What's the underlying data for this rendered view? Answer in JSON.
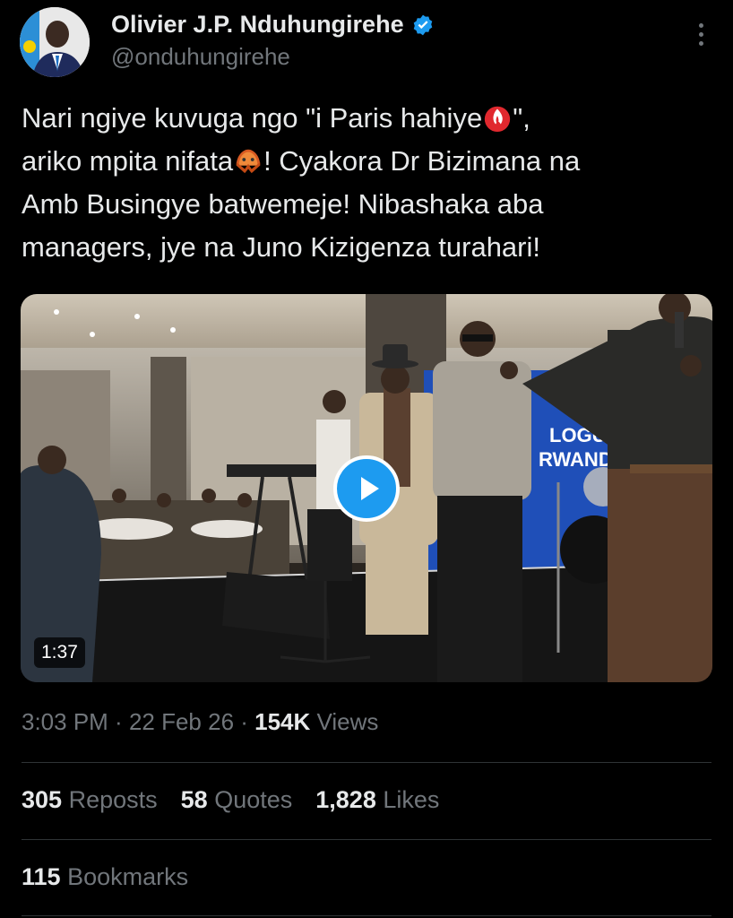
{
  "author": {
    "display_name": "Olivier J.P. Nduhungirehe",
    "handle": "@onduhungirehe",
    "verified_badge_color": "#1d9bf0"
  },
  "tweet": {
    "line1_a": "Nari ngiye kuvuga ngo \"i Paris hahiye",
    "line1_b": "\",",
    "line2_a": "ariko mpita nifata",
    "line2_b": "! Cyakora Dr Bizimana na",
    "line3": "Amb Busingye batwemeje! Nibashaka aba",
    "line4": "managers, jye na Juno Kizigenza turahari!",
    "emoji_1": "fire-emoji",
    "emoji_2": "mouth-covered-emoji"
  },
  "media": {
    "duration": "1:37",
    "play_icon": "play-icon",
    "banner_text_1": "LOGUE A",
    "banner_text_2": "RWAND"
  },
  "meta": {
    "time": "3:03 PM",
    "sep1": " · ",
    "date": "22 Feb 26",
    "sep2": " · ",
    "views_count": "154K",
    "views_label": " Views"
  },
  "stats": {
    "reposts_count": "305",
    "reposts_label": "Reposts",
    "quotes_count": "58",
    "quotes_label": "Quotes",
    "likes_count": "1,828",
    "likes_label": "Likes",
    "bookmarks_count": "115",
    "bookmarks_label": "Bookmarks"
  },
  "colors": {
    "background": "#000000",
    "text": "#e7e9ea",
    "muted": "#71767b",
    "accent": "#1d9bf0",
    "divider": "#2f3336"
  }
}
